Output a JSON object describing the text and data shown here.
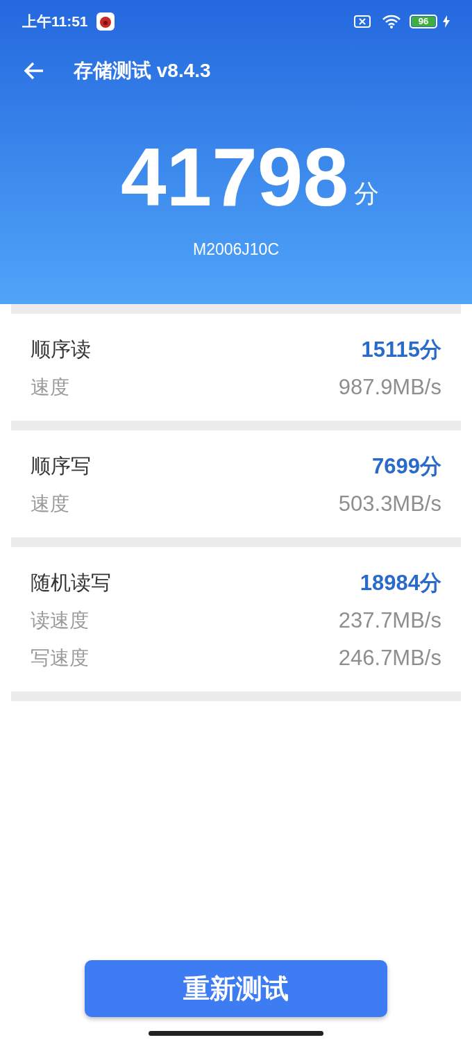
{
  "status_bar": {
    "time": "上午11:51",
    "battery": "96"
  },
  "app_bar": {
    "title": "存储测试 v8.4.3"
  },
  "summary": {
    "score": "41798",
    "unit": "分",
    "device": "M2006J10C"
  },
  "sections": [
    {
      "title": "顺序读",
      "score": "15115分",
      "rows": [
        {
          "label": "速度",
          "value": "987.9MB/s"
        }
      ]
    },
    {
      "title": "顺序写",
      "score": "7699分",
      "rows": [
        {
          "label": "速度",
          "value": "503.3MB/s"
        }
      ]
    },
    {
      "title": "随机读写",
      "score": "18984分",
      "rows": [
        {
          "label": "读速度",
          "value": "237.7MB/s"
        },
        {
          "label": "写速度",
          "value": "246.7MB/s"
        }
      ]
    }
  ],
  "retest_button": "重新测试"
}
